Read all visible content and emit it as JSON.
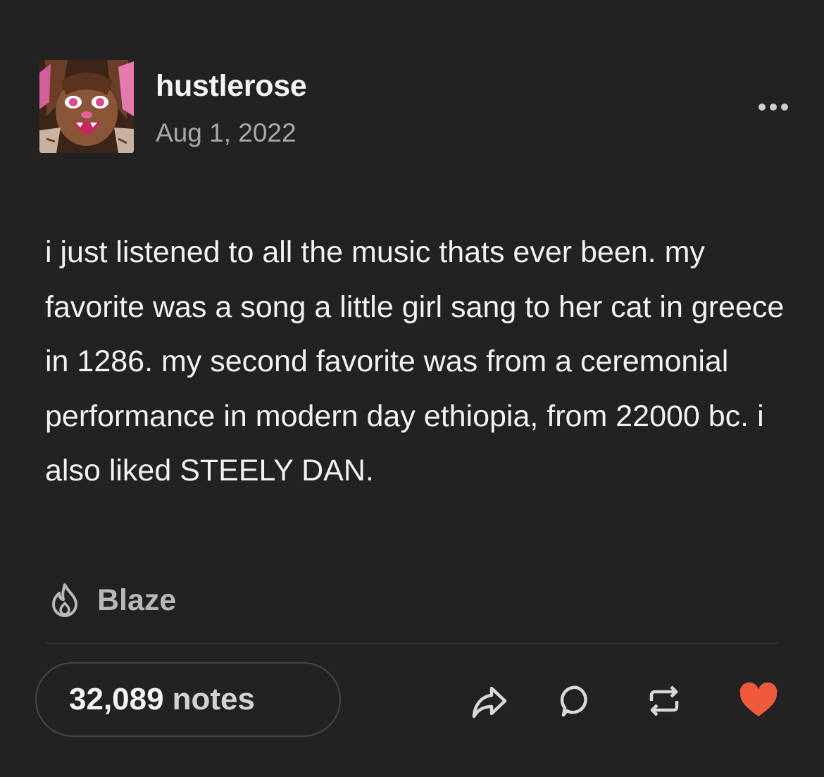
{
  "post": {
    "author": "hustlerose",
    "date": "Aug 1, 2022",
    "body": "i just listened to all the music thats ever been. my favorite was a song a little girl sang to her cat in greece in 1286. my second favorite was from a ceremonial performance in modern day ethiopia, from 22000 bc. i also liked STEELY DAN.",
    "blaze_label": "Blaze"
  },
  "footer": {
    "notes_count": "32,089",
    "notes_label": "notes"
  },
  "icons": {
    "more": "more-options-icon",
    "blaze": "flame-icon",
    "share": "share-icon",
    "reply": "reply-bubble-icon",
    "reblog": "reblog-icon",
    "like": "heart-icon"
  },
  "colors": {
    "background": "#222222",
    "like_active": "#ef5a3c",
    "secondary_text": "#a9a9a9"
  }
}
